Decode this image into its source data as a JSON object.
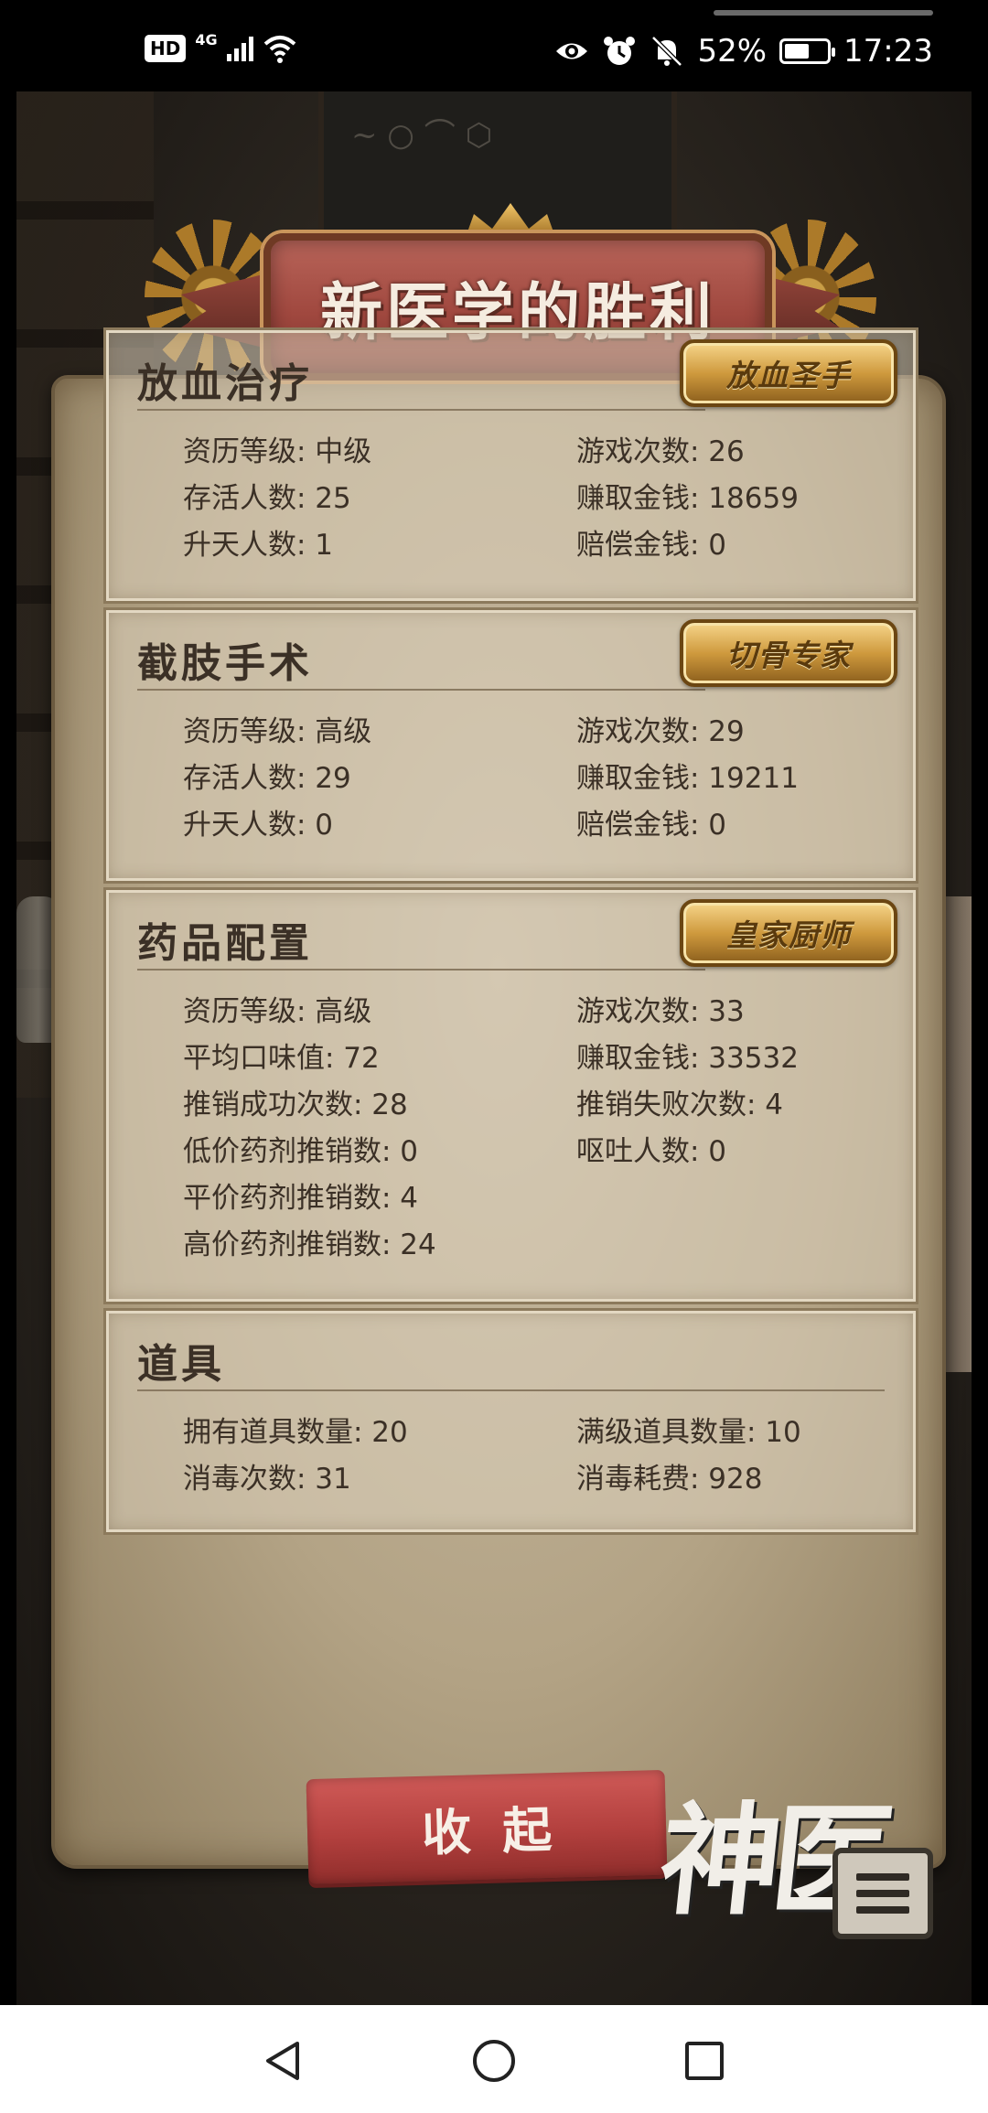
{
  "status_bar": {
    "hd": "HD",
    "network": "4G",
    "battery_percent": "52%",
    "time": "17:23",
    "icons": [
      "hd-icon",
      "signal-icon",
      "wifi-icon",
      "eye-icon",
      "alarm-icon",
      "bell-off-icon",
      "battery-charging-icon"
    ]
  },
  "title": "新医学的胜利",
  "sections": [
    {
      "title": "放血治疗",
      "badge": "放血圣手",
      "stats": [
        "资历等级: 中级",
        "游戏次数: 26",
        "存活人数: 25",
        "赚取金钱: 18659",
        "升天人数: 1",
        "赔偿金钱: 0"
      ]
    },
    {
      "title": "截肢手术",
      "badge": "切骨专家",
      "stats": [
        "资历等级: 高级",
        "游戏次数: 29",
        "存活人数: 29",
        "赚取金钱: 19211",
        "升天人数: 0",
        "赔偿金钱: 0"
      ]
    },
    {
      "title": "药品配置",
      "badge": "皇家厨师",
      "stats": [
        "资历等级: 高级",
        "游戏次数: 33",
        "平均口味值: 72",
        "赚取金钱: 33532",
        "推销成功次数: 28",
        "推销失败次数: 4",
        "低价药剂推销数: 0",
        "呕吐人数: 0",
        "平价药剂推销数: 4",
        "",
        "高价药剂推销数: 24",
        ""
      ]
    },
    {
      "title": "道具",
      "stats": [
        "拥有道具数量: 20",
        "满级道具数量: 10",
        "消毒次数: 31",
        "消毒耗费: 928"
      ]
    }
  ],
  "collapse_button": "收起",
  "logo_text": "神医",
  "menu_icon": "menu-list-icon",
  "nav": {
    "icons": [
      "back-icon",
      "home-icon",
      "recent-apps-icon"
    ]
  },
  "colors": {
    "banner": "#a0483f",
    "badge_gold": "#cf9a3e",
    "button_red": "#b3403e",
    "parchment": "#b3a385"
  }
}
